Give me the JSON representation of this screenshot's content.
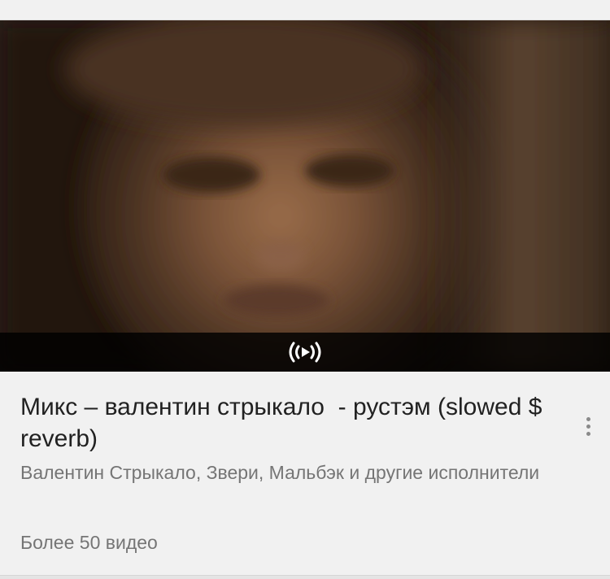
{
  "card": {
    "title": "Микс – валентин стрыкало  - рустэм (slowed $ reverb)",
    "artists": "Валентин Стрыкало, Звери, Мальбэк и другие исполнители",
    "video_count": "Более 50 видео",
    "mix_icon": "mix-broadcast-icon",
    "menu_icon": "more-vertical-icon"
  },
  "colors": {
    "title": "#212121",
    "secondary": "#757575",
    "background": "#f1f1f1",
    "overlay": "#000000"
  }
}
